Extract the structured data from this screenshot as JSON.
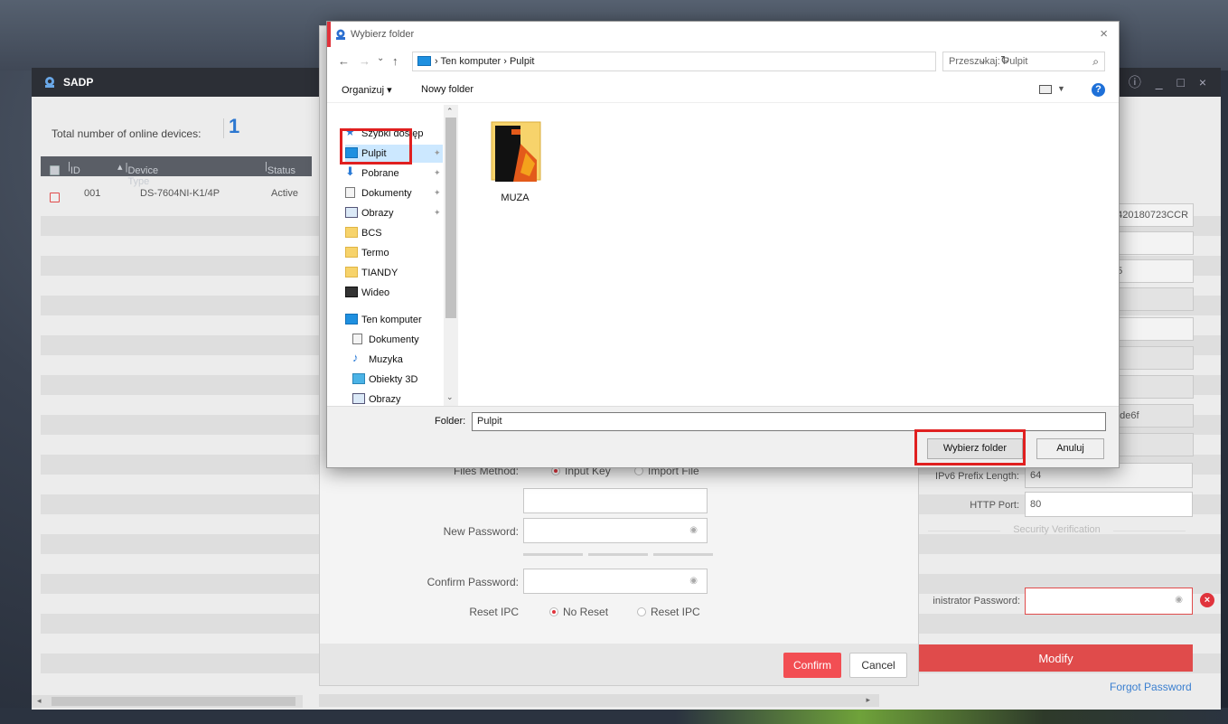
{
  "sadp": {
    "title": "SADP",
    "window_controls": "⓪ ⓘ _ □ ×",
    "online_label": "Total number of online devices:",
    "online_count": "1",
    "table": {
      "headers": {
        "id": "ID",
        "device_type": "Device Type",
        "status": "Status"
      },
      "rows": [
        {
          "id": "001",
          "device_type": "DS-7604NI-K1/4P",
          "status": "Active"
        }
      ]
    },
    "right_fields": {
      "serial_partial": "0420180723CCR",
      "port_partial": "45",
      "ipv6_partial": "3:de6f"
    }
  },
  "modify_dialog": {
    "files_method_label": "Files Method:",
    "input_key": "Input Key",
    "import_file": "Import File",
    "new_password_label": "New Password:",
    "confirm_password_label": "Confirm Password:",
    "reset_ipc_label": "Reset IPC",
    "no_reset": "No Reset",
    "reset_ipc_option": "Reset IPC",
    "confirm": "Confirm",
    "cancel": "Cancel"
  },
  "right_panel": {
    "ipv6_prefix_label": "IPv6 Prefix Length:",
    "ipv6_prefix_value": "64",
    "http_port_label": "HTTP Port:",
    "http_port_value": "80",
    "security_verification": "Security Verification",
    "admin_password_label": "inistrator Password:",
    "modify": "Modify",
    "forgot_password": "Forgot Password"
  },
  "folder_picker": {
    "title": "Wybierz folder",
    "close": "×",
    "nav_back": "←",
    "nav_forward": "→",
    "nav_recent": "⌄",
    "nav_up": "↑",
    "address": "Ten komputer  ›  Pulpit",
    "address_prefix": "›",
    "search_placeholder": "Przeszukaj: Pulpit",
    "organize": "Organizuj ▾",
    "new_folder": "Nowy folder",
    "help": "?",
    "nav_items": [
      {
        "label": "Szybki dostęp",
        "icon": "star-icon"
      },
      {
        "label": "Pulpit",
        "icon": "desktop-icon"
      },
      {
        "label": "Pobrane",
        "icon": "download-icon"
      },
      {
        "label": "Dokumenty",
        "icon": "document-icon"
      },
      {
        "label": "Obrazy",
        "icon": "pictures-icon"
      },
      {
        "label": "BCS",
        "icon": "folder-icon"
      },
      {
        "label": "Termo",
        "icon": "folder-icon"
      },
      {
        "label": "TIANDY",
        "icon": "folder-icon"
      },
      {
        "label": "Wideo",
        "icon": "video-icon"
      },
      {
        "label": "Ten komputer",
        "icon": "computer-icon"
      },
      {
        "label": "Dokumenty",
        "icon": "document-icon"
      },
      {
        "label": "Muzyka",
        "icon": "music-icon"
      },
      {
        "label": "Obiekty 3D",
        "icon": "cube-icon"
      },
      {
        "label": "Obrazy",
        "icon": "pictures-icon"
      }
    ],
    "files": [
      {
        "name": "MUZA",
        "icon": "folder-icon"
      }
    ],
    "folder_label": "Folder:",
    "folder_value": "Pulpit",
    "select_button": "Wybierz folder",
    "cancel_button": "Anuluj",
    "colors": {
      "highlight": "#e02020",
      "selection": "#cce8ff",
      "accent": "#e0333c"
    }
  }
}
